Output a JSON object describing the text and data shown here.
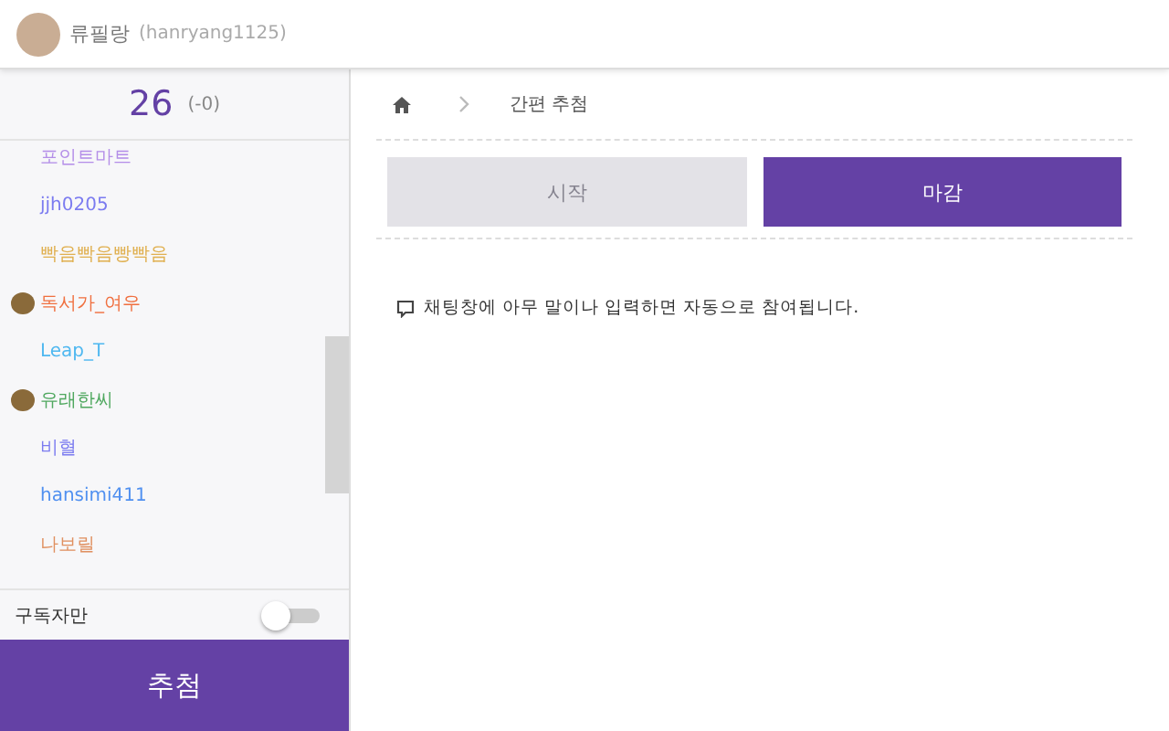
{
  "header": {
    "user_name": "류필랑",
    "user_id": "(hanryang1125)"
  },
  "sidebar": {
    "count": "26",
    "count_delta": "(-0)",
    "participants": [
      {
        "name": "포인트마트",
        "color": "#b48ee8",
        "badge": false
      },
      {
        "name": "jjh0205",
        "color": "#7b7bf0",
        "badge": false
      },
      {
        "name": "빡음빡음빵빡음",
        "color": "#e0b050",
        "badge": false
      },
      {
        "name": "독서가_여우",
        "color": "#f07040",
        "badge": true
      },
      {
        "name": "Leap_T",
        "color": "#50b8f0",
        "badge": false
      },
      {
        "name": "유래한씨",
        "color": "#50a860",
        "badge": true
      },
      {
        "name": "비혈",
        "color": "#7b7bf0",
        "badge": false
      },
      {
        "name": "hansimi411",
        "color": "#5090f0",
        "badge": false
      },
      {
        "name": "나보릴",
        "color": "#e09060",
        "badge": false
      }
    ],
    "subscriber_only": {
      "label": "구독자만",
      "on": false
    },
    "draw_button": "추첨"
  },
  "breadcrumb": {
    "page": "간편 추첨"
  },
  "buttons": [
    {
      "label": "시작",
      "disabled": true
    },
    {
      "label": "마감",
      "disabled": false
    }
  ],
  "notice": "채팅창에 아무 말이나 입력하면 자동으로 참여됩니다."
}
